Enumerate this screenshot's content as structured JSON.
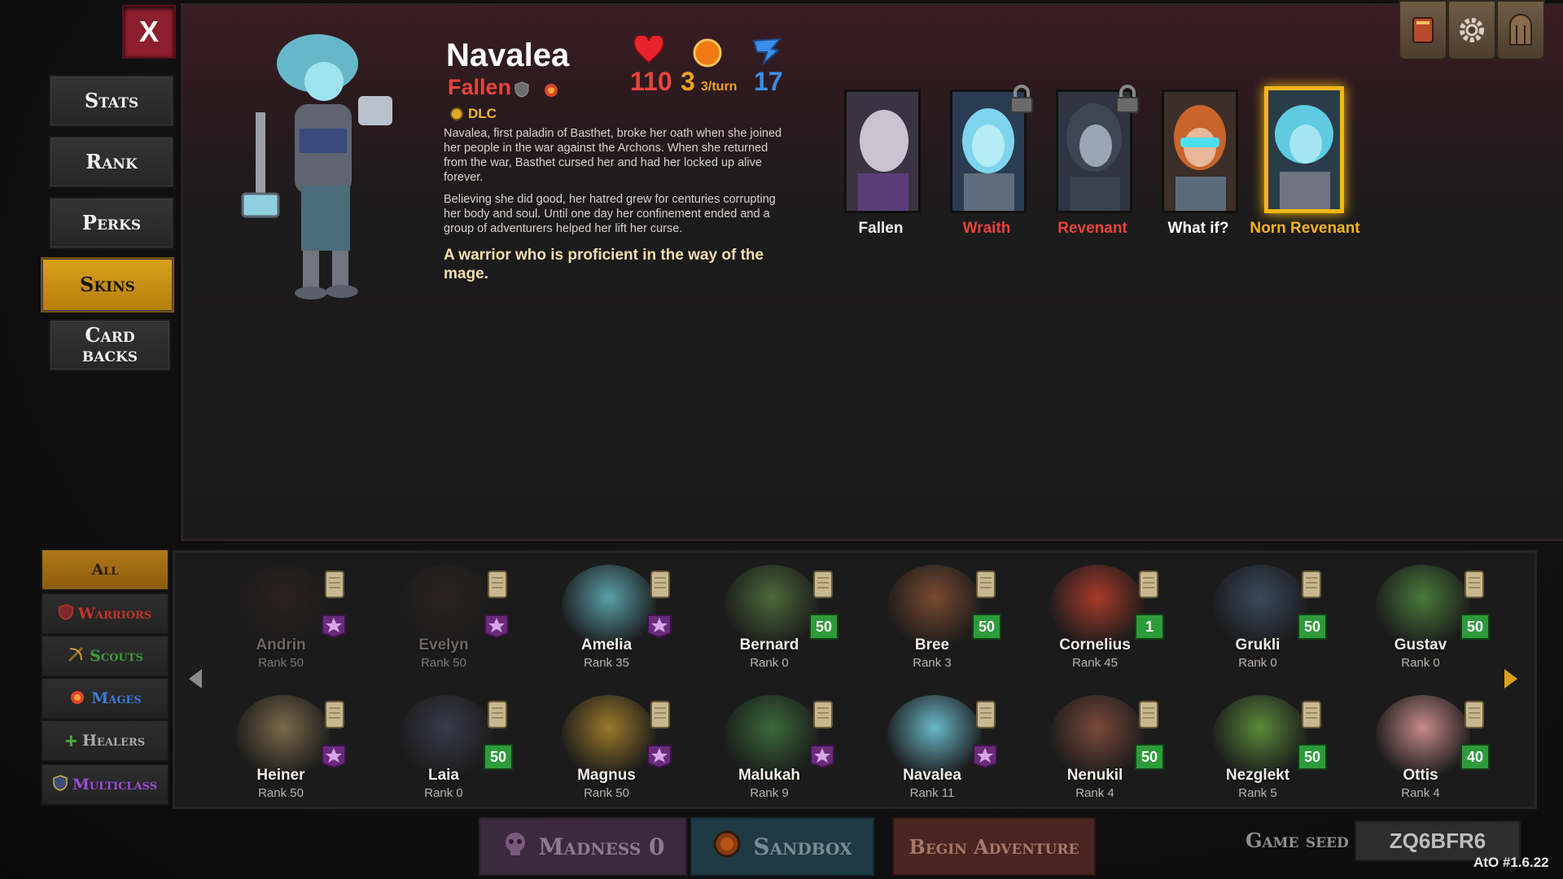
{
  "close_label": "X",
  "menu": [
    {
      "label": "Stats",
      "active": false
    },
    {
      "label": "Rank",
      "active": false
    },
    {
      "label": "Perks",
      "active": false
    },
    {
      "label": "Skins",
      "active": true
    },
    {
      "label": "Card backs",
      "active": false
    }
  ],
  "hero": {
    "name": "Navalea",
    "class": "Fallen",
    "dlc": "DLC",
    "hp": "110",
    "energy": "3",
    "energy_unit": "3/turn",
    "speed": "17",
    "description_1": "Navalea, first paladin of Basthet, broke her oath when she joined her people in the war against the Archons. When she returned from the war, Basthet cursed her and had her locked up alive forever.",
    "description_2": "Believing she did good, her hatred grew for centuries corrupting her body and soul. Until one day her confinement ended and a group of adventurers helped her lift her curse.",
    "tagline": "A warrior who is proficient in the way of the mage."
  },
  "skins": [
    {
      "name": "Fallen",
      "color": "#ffffff",
      "locked": false,
      "selected": false
    },
    {
      "name": "Wraith",
      "color": "#e8443c",
      "locked": true,
      "selected": false
    },
    {
      "name": "Revenant",
      "color": "#e8443c",
      "locked": true,
      "selected": false
    },
    {
      "name": "What if?",
      "color": "#ffffff",
      "locked": false,
      "selected": false
    },
    {
      "name": "Norn Revenant",
      "color": "#f5b516",
      "locked": false,
      "selected": true
    }
  ],
  "filters": [
    {
      "label": "All",
      "color": "#2a1a04",
      "icon": ""
    },
    {
      "label": "Warriors",
      "color": "#c0332c",
      "icon": "shield-icon"
    },
    {
      "label": "Scouts",
      "color": "#3f9a3a",
      "icon": "bow-icon"
    },
    {
      "label": "Mages",
      "color": "#3c78d8",
      "icon": "fire-icon"
    },
    {
      "label": "Healers",
      "color": "#aaaaaa",
      "icon": "cross-icon"
    },
    {
      "label": "Multiclass",
      "color": "#9a4cd8",
      "icon": "multiclass-shield-icon"
    }
  ],
  "heroes_row1": [
    {
      "name": "Andrin",
      "rank": "Rank 50",
      "badge": "star",
      "dim": true
    },
    {
      "name": "Evelyn",
      "rank": "Rank 50",
      "badge": "star",
      "dim": true
    },
    {
      "name": "Amelia",
      "rank": "Rank 35",
      "badge": "star",
      "dim": false
    },
    {
      "name": "Bernard",
      "rank": "Rank 0",
      "badge": "50",
      "dim": false
    },
    {
      "name": "Bree",
      "rank": "Rank 3",
      "badge": "50",
      "dim": false
    },
    {
      "name": "Cornelius",
      "rank": "Rank 45",
      "badge": "1",
      "dim": false
    },
    {
      "name": "Grukli",
      "rank": "Rank 0",
      "badge": "50",
      "dim": false
    },
    {
      "name": "Gustav",
      "rank": "Rank 0",
      "badge": "50",
      "dim": false
    }
  ],
  "heroes_row2": [
    {
      "name": "Heiner",
      "rank": "Rank 50",
      "badge": "star",
      "dim": false
    },
    {
      "name": "Laia",
      "rank": "Rank 0",
      "badge": "50",
      "dim": false
    },
    {
      "name": "Magnus",
      "rank": "Rank 50",
      "badge": "star",
      "dim": false
    },
    {
      "name": "Malukah",
      "rank": "Rank 9",
      "badge": "star",
      "dim": false
    },
    {
      "name": "Navalea",
      "rank": "Rank 11",
      "badge": "star",
      "dim": false
    },
    {
      "name": "Nenukil",
      "rank": "Rank 4",
      "badge": "50",
      "dim": false
    },
    {
      "name": "Nezglekt",
      "rank": "Rank 5",
      "badge": "50",
      "dim": false
    },
    {
      "name": "Ottis",
      "rank": "Rank 4",
      "badge": "40",
      "dim": false
    }
  ],
  "bottom": {
    "madness": "Madness 0",
    "sandbox": "Sandbox",
    "begin": "Begin Adventure",
    "seed_label": "Game seed",
    "seed_value": "ZQ6BFR6",
    "version": "AtO #1.6.22"
  },
  "colors": {
    "accent_gold": "#d8a11c",
    "class_red": "#e8443c",
    "speed_blue": "#3a8ee8",
    "energy_orange": "#f0a020"
  }
}
